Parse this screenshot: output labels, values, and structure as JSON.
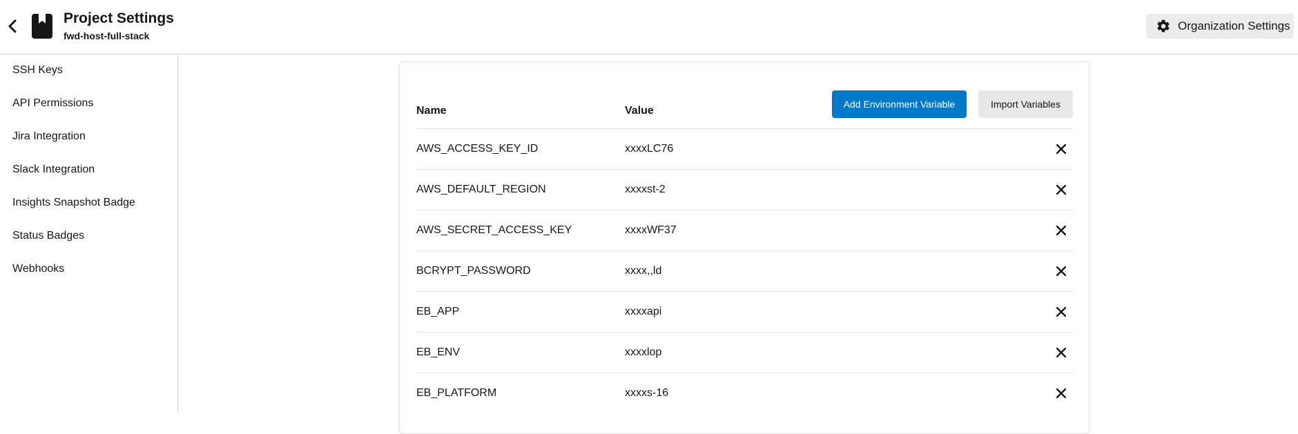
{
  "header": {
    "title": "Project Settings",
    "subtitle": "fwd-host-full-stack",
    "org_settings_label": "Organization Settings"
  },
  "sidebar": {
    "items": [
      {
        "label": "SSH Keys"
      },
      {
        "label": "API Permissions"
      },
      {
        "label": "Jira Integration"
      },
      {
        "label": "Slack Integration"
      },
      {
        "label": "Insights Snapshot Badge"
      },
      {
        "label": "Status Badges"
      },
      {
        "label": "Webhooks"
      }
    ]
  },
  "env_table": {
    "col_name": "Name",
    "col_value": "Value",
    "add_button": "Add Environment Variable",
    "import_button": "Import Variables",
    "rows": [
      {
        "name": "AWS_ACCESS_KEY_ID",
        "value": "xxxxLC76"
      },
      {
        "name": "AWS_DEFAULT_REGION",
        "value": "xxxxst-2"
      },
      {
        "name": "AWS_SECRET_ACCESS_KEY",
        "value": "xxxxWF37"
      },
      {
        "name": "BCRYPT_PASSWORD",
        "value": "xxxx,,ld"
      },
      {
        "name": "EB_APP",
        "value": "xxxxapi"
      },
      {
        "name": "EB_ENV",
        "value": "xxxxlop"
      },
      {
        "name": "EB_PLATFORM",
        "value": "xxxxs-16"
      }
    ]
  },
  "colors": {
    "primary": "#0078ca",
    "secondary_button": "#e8e8e8",
    "text": "#161616",
    "border": "#e3e3e3"
  },
  "icons": {
    "back": "chevron-left-icon",
    "project": "bookmark-book-icon",
    "settings": "gear-icon",
    "delete": "close-icon"
  }
}
